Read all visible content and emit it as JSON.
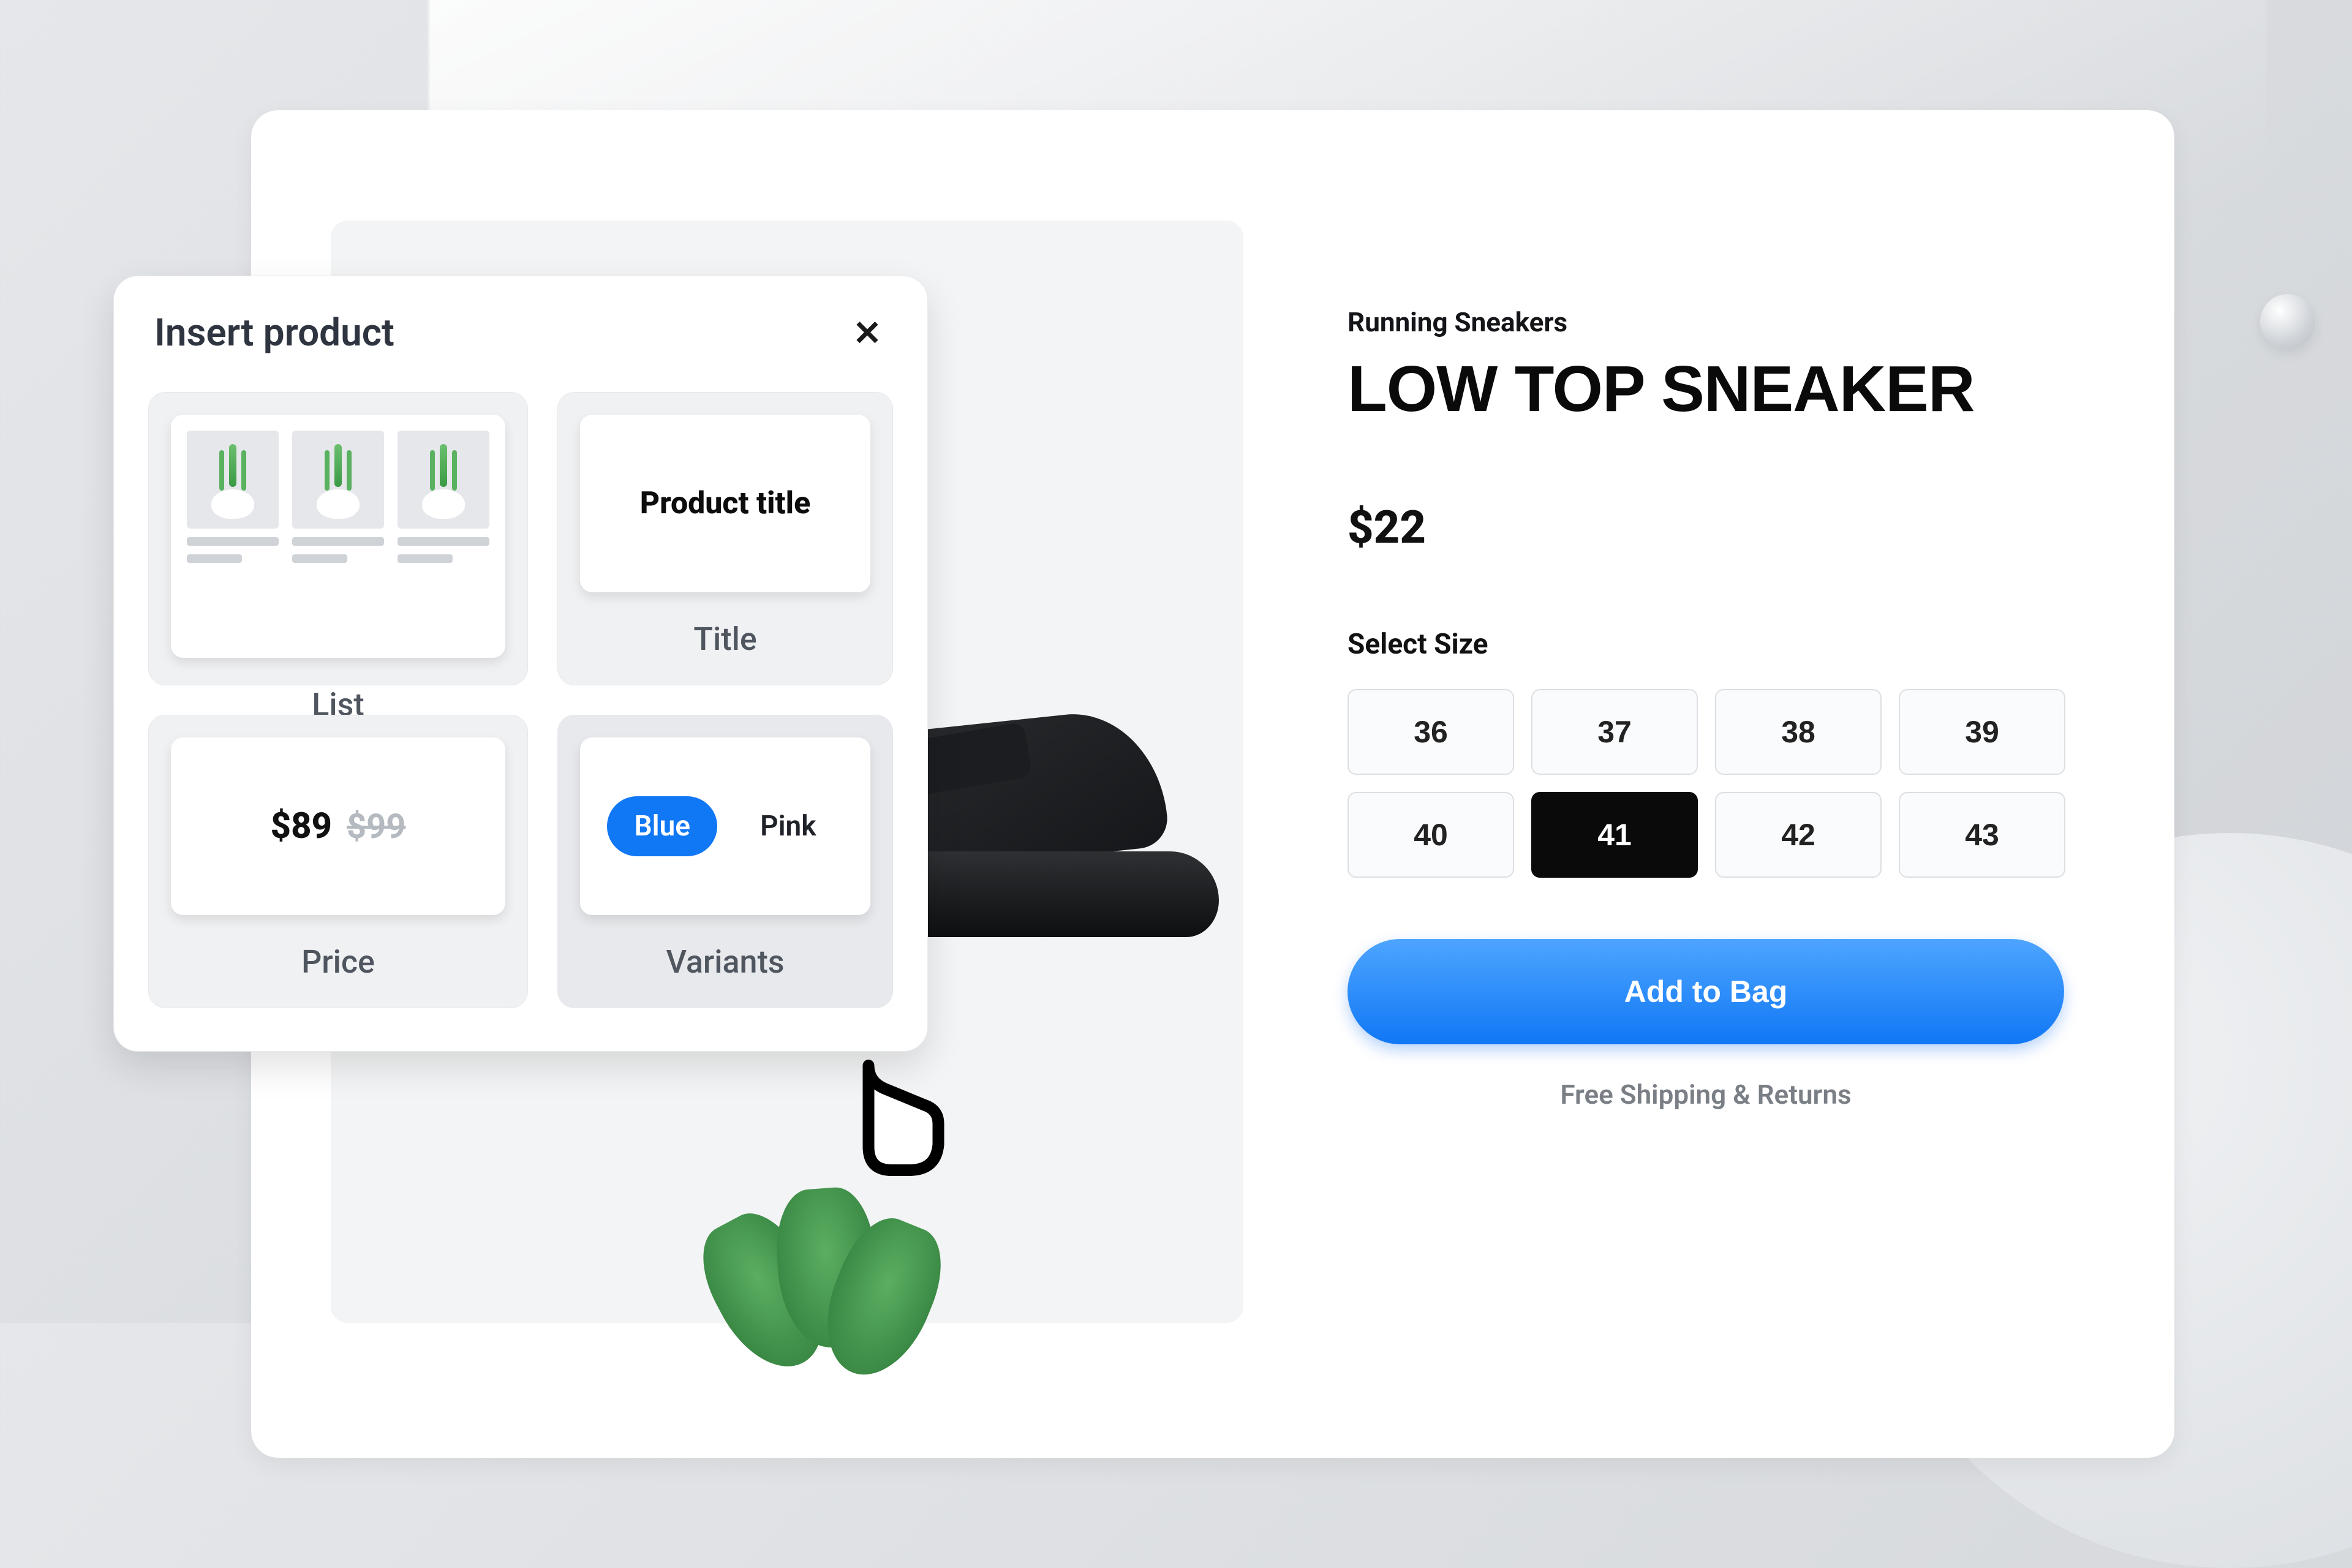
{
  "product": {
    "category": "Running Sneakers",
    "title": "LOW TOP SNEAKER",
    "price": "$22",
    "size_label": "Select Size",
    "sizes": [
      "36",
      "37",
      "38",
      "39",
      "40",
      "41",
      "42",
      "43"
    ],
    "selected_size": "41",
    "cta": "Add to Bag",
    "shipping_note": "Free Shipping & Returns"
  },
  "popover": {
    "title": "Insert product",
    "widgets": {
      "list": {
        "label": "List"
      },
      "title": {
        "label": "Title",
        "sample": "Product title"
      },
      "price": {
        "label": "Price",
        "current": "$89",
        "old": "$99"
      },
      "variants": {
        "label": "Variants",
        "option_a": "Blue",
        "option_b": "Pink"
      }
    }
  }
}
